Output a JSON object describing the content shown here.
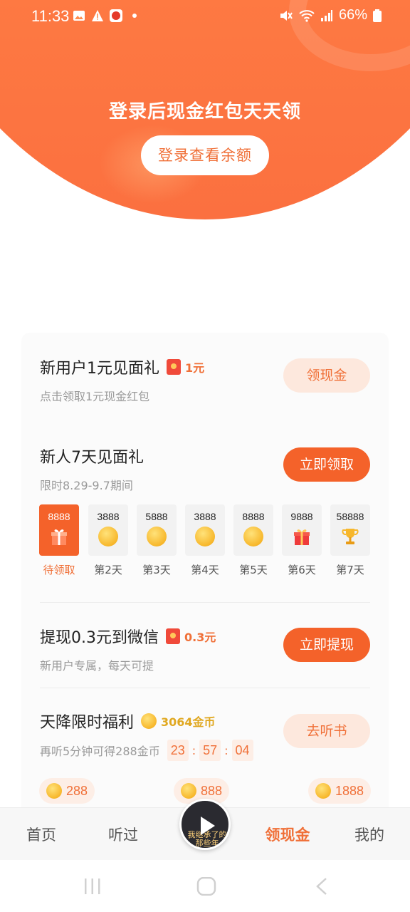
{
  "status_bar": {
    "time": "11:33",
    "battery": "66%"
  },
  "header": {
    "title": "登录后现金红包天天领",
    "login_button": "登录查看余额"
  },
  "tasks": {
    "new_user_gift": {
      "title": "新用户1元见面礼",
      "reward": "1元",
      "subtitle": "点击领取1元现金红包",
      "button": "领现金"
    },
    "seven_day_gift": {
      "title": "新人7天见面礼",
      "subtitle": "限时8.29-9.7期间",
      "button": "立即领取",
      "days": [
        {
          "amount": "8888",
          "label": "待领取",
          "icon": "gift-icon",
          "active": true
        },
        {
          "amount": "3888",
          "label": "第2天",
          "icon": "coin-icon"
        },
        {
          "amount": "5888",
          "label": "第3天",
          "icon": "coin-icon"
        },
        {
          "amount": "3888",
          "label": "第4天",
          "icon": "coin-icon"
        },
        {
          "amount": "8888",
          "label": "第5天",
          "icon": "coin-icon"
        },
        {
          "amount": "9888",
          "label": "第6天",
          "icon": "gift-icon"
        },
        {
          "amount": "58888",
          "label": "第7天",
          "icon": "trophy-icon"
        }
      ]
    },
    "withdraw": {
      "title": "提现0.3元到微信",
      "reward": "0.3元",
      "subtitle": "新用户专属，每天可提",
      "button": "立即提现"
    },
    "limited_welfare": {
      "title": "天降限时福利",
      "reward": "3064金币",
      "subtitle": "再听5分钟可得288金币",
      "countdown": {
        "h": "23",
        "m": "57",
        "s": "04"
      },
      "button": "去听书",
      "bubbles": [
        "288",
        "888",
        "1888"
      ]
    }
  },
  "bottom_nav": {
    "items": [
      "首页",
      "听过",
      "领现金",
      "我的"
    ],
    "active": "领现金",
    "center_disc_text": "我继承了的那些年"
  },
  "colors": {
    "accent": "#f4622a",
    "accent_text": "#f07038",
    "header": "#ff8d4f"
  }
}
